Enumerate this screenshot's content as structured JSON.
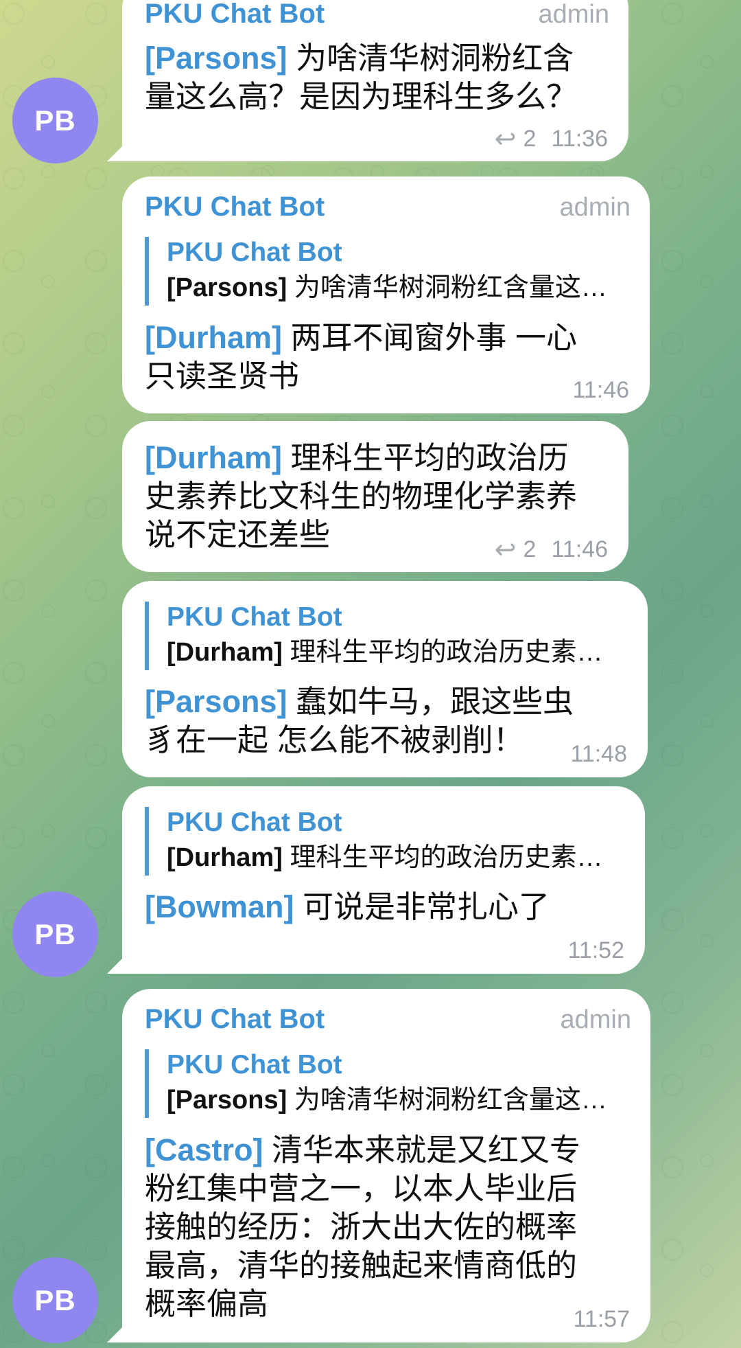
{
  "avatar_initials": "PB",
  "messages": [
    {
      "sender": "PKU Chat Bot",
      "role": "admin",
      "tag": "[Parsons]",
      "text": "为啥清华树洞粉红含量这么高？是因为理科生多么？",
      "line1": "为啥清华树洞粉红含",
      "line2": "量这么高？是因为理科生多么？",
      "replies": "2",
      "time": "11:36"
    },
    {
      "sender": "PKU Chat Bot",
      "role": "admin",
      "quote_sender": "PKU Chat Bot",
      "quote_tag": "[Parsons]",
      "quote_text": "为啥清华树洞粉红含量这…",
      "tag": "[Durham]",
      "line1": "两耳不闻窗外事 一心",
      "line2": "只读圣贤书",
      "time": "11:46"
    },
    {
      "tag": "[Durham]",
      "line1": "理科生平均的政治历",
      "line2": "史素养比文科生的物理化学素养",
      "line3": "说不定还差些",
      "replies": "2",
      "time": "11:46"
    },
    {
      "quote_sender": "PKU Chat Bot",
      "quote_tag": "[Durham]",
      "quote_text": "理科生平均的政治历史素…",
      "tag": "[Parsons]",
      "line1": "蠢如牛马，跟这些虫",
      "line2": "豸在一起 怎么能不被剥削！",
      "time": "11:48"
    },
    {
      "quote_sender": "PKU Chat Bot",
      "quote_tag": "[Durham]",
      "quote_text": "理科生平均的政治历史素…",
      "tag": "[Bowman]",
      "line1": "可说是非常扎心了",
      "time": "11:52"
    },
    {
      "sender": "PKU Chat Bot",
      "role": "admin",
      "quote_sender": "PKU Chat Bot",
      "quote_tag": "[Parsons]",
      "quote_text": "为啥清华树洞粉红含量这…",
      "tag": "[Castro]",
      "line1": "清华本来就是又红又专",
      "line2": "粉红集中营之一，以本人毕业后",
      "line3": "接触的经历：浙大出大佐的概率",
      "line4": "最高，清华的接触起来情商低的",
      "line5": "概率偏高",
      "time": "11:57"
    }
  ]
}
